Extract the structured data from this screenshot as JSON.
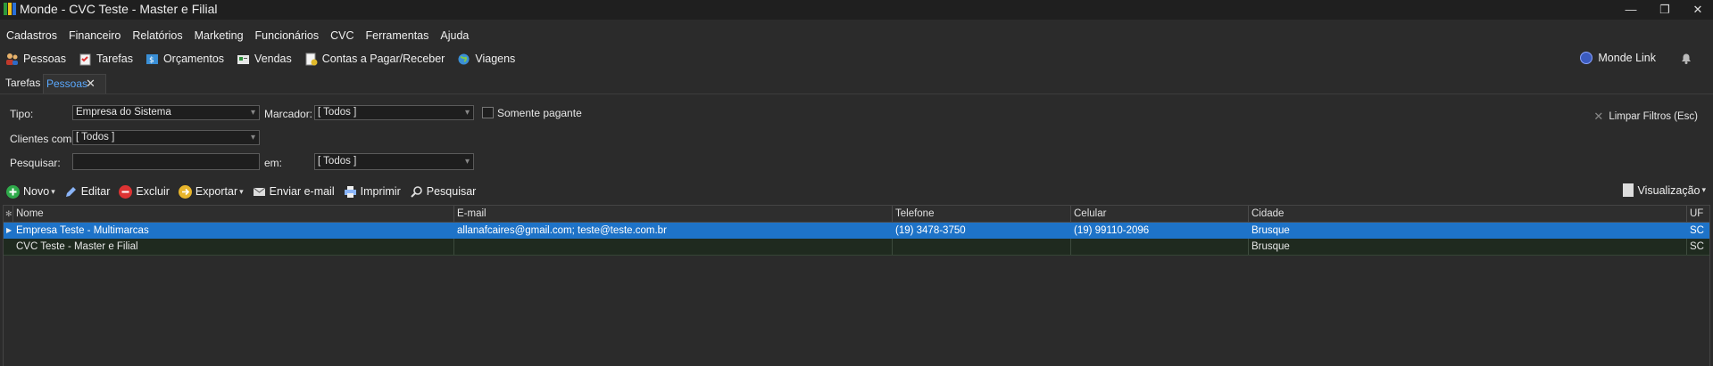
{
  "window": {
    "title": "Monde - CVC Teste - Master e Filial",
    "minimize": "—",
    "restore": "❐",
    "close": "✕"
  },
  "menu": [
    "Cadastros",
    "Financeiro",
    "Relatórios",
    "Marketing",
    "Funcionários",
    "CVC",
    "Ferramentas",
    "Ajuda"
  ],
  "quickbar": [
    "Pessoas",
    "Tarefas",
    "Orçamentos",
    "Vendas",
    "Contas a Pagar/Receber",
    "Viagens"
  ],
  "monde_link": "Monde Link",
  "tabs": {
    "tarefas": "Tarefas",
    "pessoas": "Pessoas",
    "close": "✕"
  },
  "filters": {
    "tipo_label": "Tipo:",
    "tipo_value": "Empresa do Sistema",
    "marcador_label": "Marcador:",
    "marcador_value": "[ Todos ]",
    "somente_pagante": "Somente pagante",
    "clientes_label": "Clientes com:",
    "clientes_value": "[ Todos ]",
    "pesquisar_label": "Pesquisar:",
    "pesquisar_value": "",
    "em_label": "em:",
    "em_value": "[ Todos ]",
    "clear": "Limpar Filtros (Esc)"
  },
  "actions": {
    "novo": "Novo",
    "editar": "Editar",
    "excluir": "Excluir",
    "exportar": "Exportar",
    "enviar_email": "Enviar e-mail",
    "imprimir": "Imprimir",
    "pesquisar": "Pesquisar",
    "visualizacao": "Visualização"
  },
  "grid": {
    "columns": [
      "Nome",
      "E-mail",
      "Telefone",
      "Celular",
      "Cidade",
      "UF"
    ],
    "rows": [
      {
        "nome": "Empresa Teste - Multimarcas",
        "email": "allanafcaires@gmail.com; teste@teste.com.br",
        "telefone": "(19) 3478-3750",
        "celular": "(19) 99110-2096",
        "cidade": "Brusque",
        "uf": "SC"
      },
      {
        "nome": "CVC Teste - Master e Filial",
        "email": "",
        "telefone": "",
        "celular": "",
        "cidade": "Brusque",
        "uf": "SC"
      }
    ]
  },
  "colors": {
    "accent": "#1e73c8",
    "tab_active": "#5aa9ff",
    "background": "#2b2b2b"
  }
}
